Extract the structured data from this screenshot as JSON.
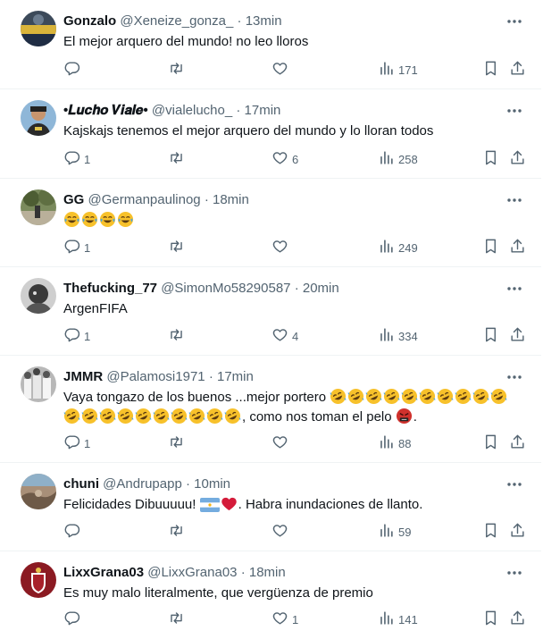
{
  "tweets": [
    {
      "name": "Gonzalo",
      "handle": "@Xeneize_gonza_",
      "time": "13min",
      "text": "El mejor arquero del mundo! no leo lloros",
      "replies": "",
      "likes": "",
      "views": "171"
    },
    {
      "name": "•𝑳𝒖𝒄𝒉𝒐 𝑽𝒊𝒂𝒍𝒆•",
      "handle": "@vialelucho_",
      "time": "17min",
      "text": "Kajskajs tenemos el mejor arquero del mundo y lo lloran todos",
      "replies": "1",
      "likes": "6",
      "views": "258"
    },
    {
      "name": "GG",
      "handle": "@Germanpaulinog",
      "time": "18min",
      "text": "",
      "emoji_line": [
        "tears-joy",
        "tears-joy",
        "tears-joy",
        "tears-joy"
      ],
      "replies": "1",
      "likes": "",
      "views": "249"
    },
    {
      "name": "Thefucking_77",
      "handle": "@SimonMo58290587",
      "time": "20min",
      "text": "ArgenFIFA",
      "replies": "1",
      "likes": "4",
      "views": "334"
    },
    {
      "name": "JMMR",
      "handle": "@Palamosi1971",
      "time": "17min",
      "text_line1": "Vaya tongazo de los buenos ...mejor portero",
      "text_line2": ", como nos toman el pelo",
      "replies": "1",
      "likes": "",
      "views": "88"
    },
    {
      "name": "chuni",
      "handle": "@Andrupapp",
      "time": "10min",
      "text_a": "Felicidades Dibuuuuu!",
      "text_b": ". Habra inundaciones de llanto.",
      "replies": "",
      "likes": "",
      "views": "59"
    },
    {
      "name": "LixxGrana03",
      "handle": "@LixxGrana03",
      "time": "18min",
      "text": "Es muy malo literalmente, que vergüenza de premio",
      "replies": "",
      "likes": "1",
      "views": "141"
    }
  ],
  "dot": "·",
  "colors": {
    "muted": "#536471",
    "text": "#0f1419",
    "divider": "#eff3f4",
    "emoji": "#f7c12b",
    "heart": "#d41b3a"
  }
}
